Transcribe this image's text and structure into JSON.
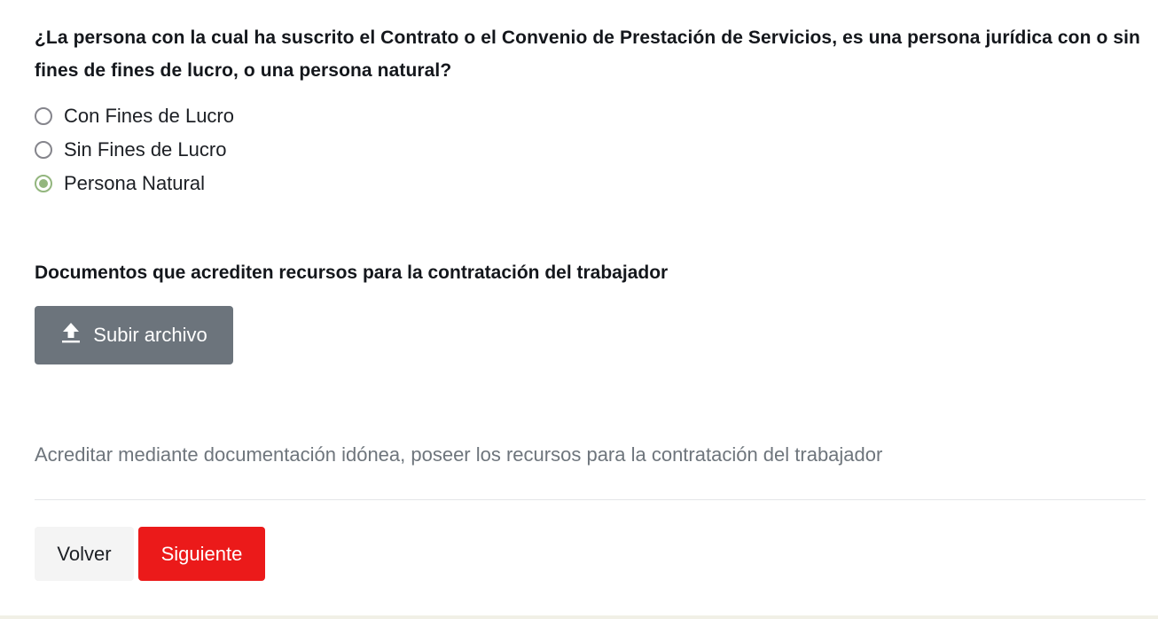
{
  "question": {
    "text": "¿La persona con la cual ha suscrito el Contrato o el Convenio de Prestación de Servicios, es una persona jurídica con o sin fines de fines de lucro, o una persona natural?"
  },
  "options": [
    {
      "label": "Con Fines de Lucro",
      "checked": false
    },
    {
      "label": "Sin Fines de Lucro",
      "checked": false
    },
    {
      "label": "Persona Natural",
      "checked": true
    }
  ],
  "documents": {
    "title": "Documentos que acrediten recursos para la contratación del trabajador",
    "upload_label": "Subir archivo",
    "upload_icon": "upload-icon",
    "hint": "Acreditar mediante documentación idónea, poseer los recursos para la contratación del trabajador"
  },
  "actions": {
    "back_label": "Volver",
    "next_label": "Siguiente"
  },
  "colors": {
    "radio_checked": "#93b67e",
    "upload_button": "#6c747c",
    "next_button": "#eb1a1a",
    "back_button": "#f4f4f4"
  }
}
